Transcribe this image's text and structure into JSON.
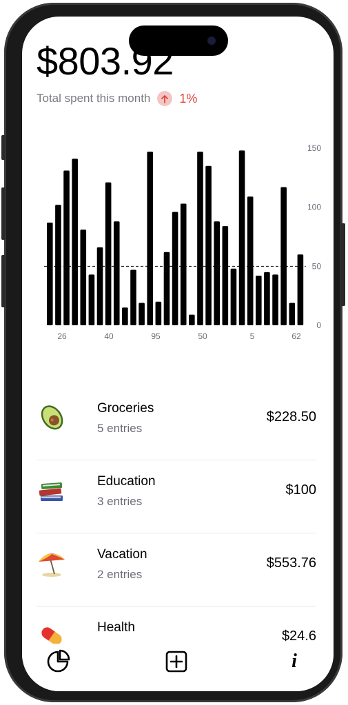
{
  "summary": {
    "total": "$803.92",
    "label": "Total spent this month",
    "change_pct": "1%",
    "trend_icon": "arrow-up-circle-icon",
    "trend_color": "#e0453a"
  },
  "chart_data": {
    "type": "bar",
    "values": [
      87,
      102,
      131,
      141,
      81,
      43,
      66,
      121,
      88,
      15,
      47,
      19,
      147,
      20,
      62,
      96,
      103,
      9,
      147,
      135,
      88,
      84,
      48,
      148,
      109,
      42,
      45,
      43,
      117,
      19,
      60
    ],
    "x_tick_labels": [
      "26",
      "40",
      "95",
      "50",
      "5",
      "62"
    ],
    "y_ticks": [
      0,
      50,
      100,
      150
    ],
    "ylim": [
      0,
      150
    ],
    "reference_line": 50,
    "bar_color": "#000000"
  },
  "categories": [
    {
      "name": "Groceries",
      "entries": "5 entries",
      "amount": "$228.50",
      "icon": "avocado-icon"
    },
    {
      "name": "Education",
      "entries": "3 entries",
      "amount": "$100",
      "icon": "books-icon"
    },
    {
      "name": "Vacation",
      "entries": "2 entries",
      "amount": "$553.76",
      "icon": "beach-umbrella-icon"
    },
    {
      "name": "Health",
      "entries": "",
      "amount": "$24.6",
      "icon": "pill-icon"
    }
  ],
  "tabbar": {
    "items": [
      {
        "name": "stats",
        "icon": "pie-chart-icon"
      },
      {
        "name": "add",
        "icon": "add-square-icon"
      },
      {
        "name": "info",
        "icon": "info-icon",
        "glyph": "i"
      }
    ]
  }
}
